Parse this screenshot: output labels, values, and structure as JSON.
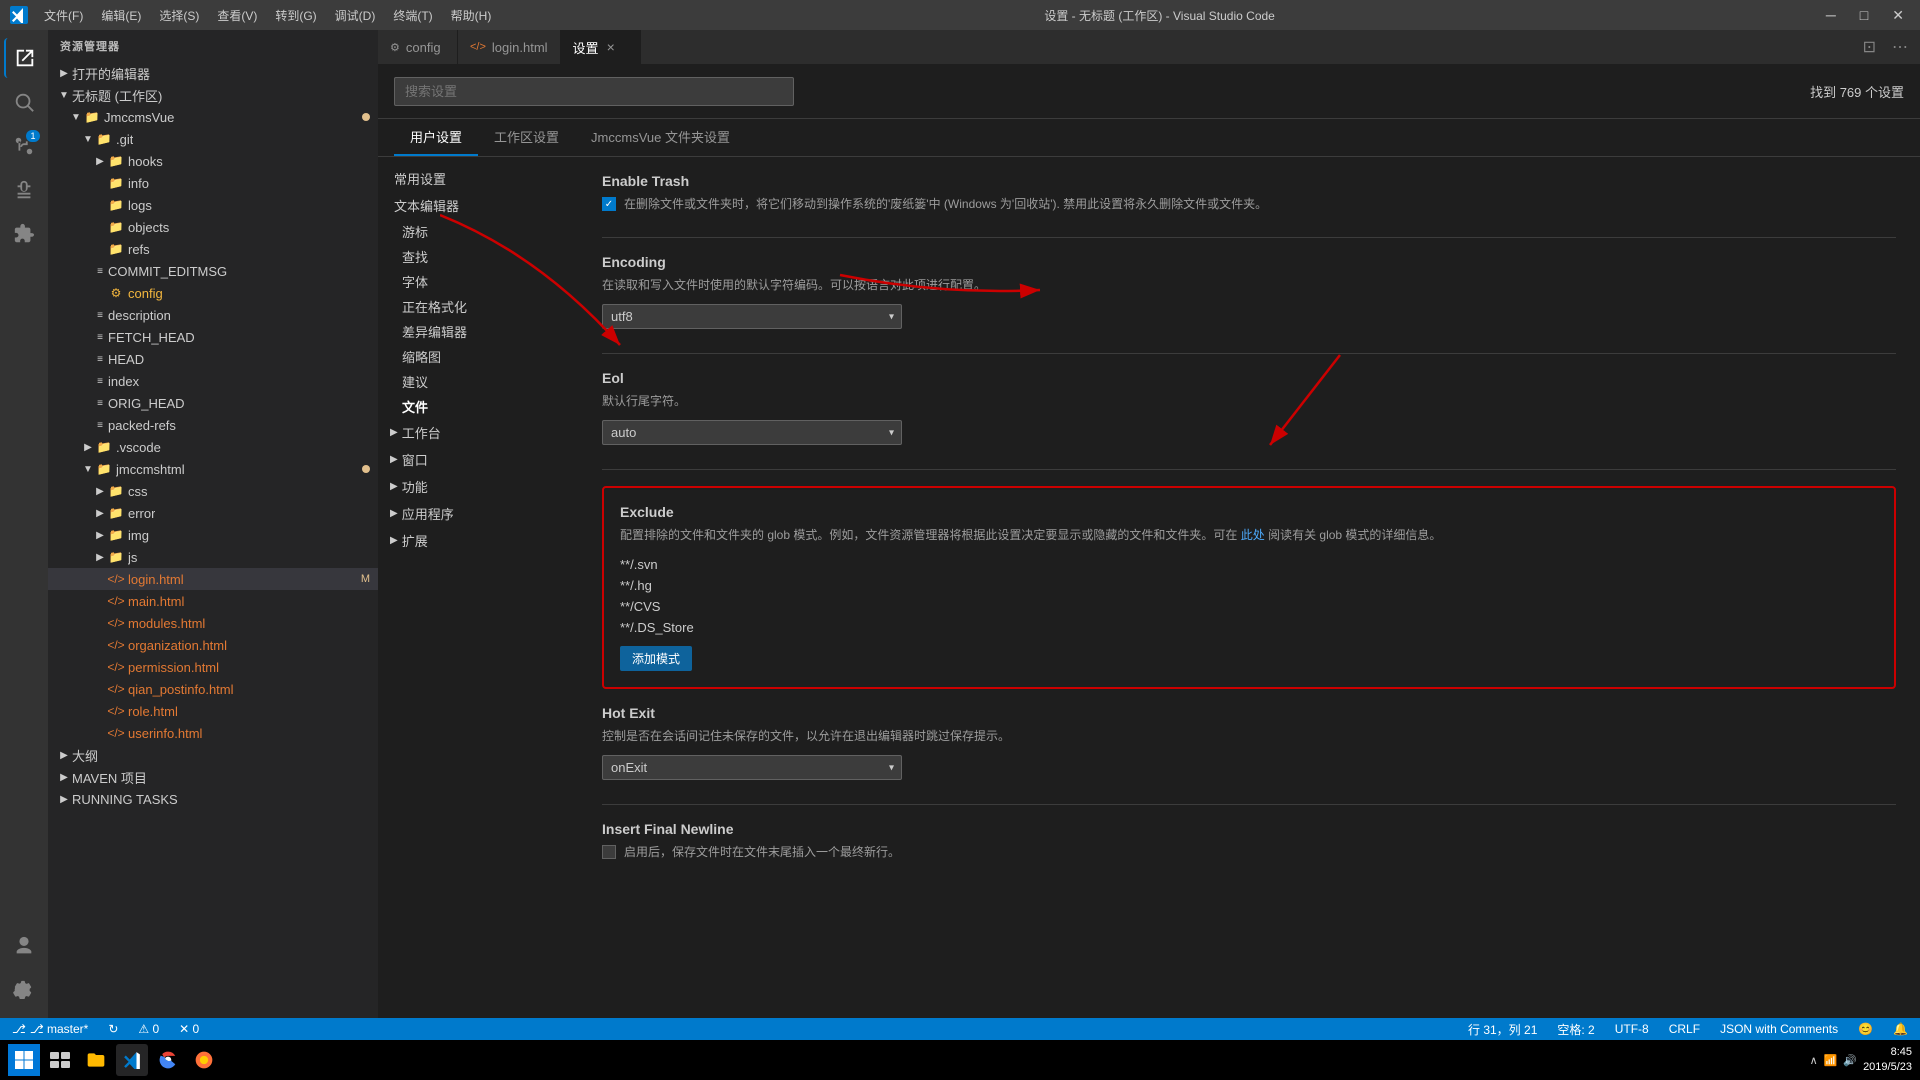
{
  "titleBar": {
    "logo": "VS",
    "menus": [
      "文件(F)",
      "编辑(E)",
      "选择(S)",
      "查看(V)",
      "转到(G)",
      "调试(D)",
      "终端(T)",
      "帮助(H)"
    ],
    "title": "设置 - 无标题 (工作区) - Visual Studio Code",
    "btnMinimize": "─",
    "btnMaximize": "□",
    "btnClose": "✕"
  },
  "activityBar": {
    "icons": [
      {
        "name": "explorer-icon",
        "symbol": "⎘",
        "active": true
      },
      {
        "name": "search-icon",
        "symbol": "🔍",
        "active": false
      },
      {
        "name": "source-control-icon",
        "symbol": "⑂",
        "active": false,
        "badge": "1"
      },
      {
        "name": "debug-icon",
        "symbol": "▷",
        "active": false
      },
      {
        "name": "extensions-icon",
        "symbol": "⊞",
        "active": false
      }
    ],
    "bottomIcons": [
      {
        "name": "account-icon",
        "symbol": "👤"
      },
      {
        "name": "settings-gear-icon",
        "symbol": "⚙"
      }
    ]
  },
  "sidebar": {
    "header": "资源管理器",
    "sections": [
      {
        "label": "打开的编辑器",
        "collapsed": true,
        "indent": 0
      },
      {
        "label": "无标题 (工作区)",
        "collapsed": false,
        "indent": 0
      },
      {
        "label": "JmccmsVue",
        "collapsed": false,
        "indent": 1,
        "dot": true
      },
      {
        "label": ".git",
        "collapsed": false,
        "indent": 2
      },
      {
        "label": "hooks",
        "collapsed": true,
        "indent": 3,
        "isFolder": true
      },
      {
        "label": "info",
        "indent": 3,
        "isFolder": true
      },
      {
        "label": "logs",
        "indent": 3,
        "isFolder": true
      },
      {
        "label": "objects",
        "indent": 3,
        "isFolder": true
      },
      {
        "label": "refs",
        "indent": 3,
        "isFolder": true
      },
      {
        "label": "COMMIT_EDITMSG",
        "indent": 3,
        "isFile": true
      },
      {
        "label": "config",
        "indent": 3,
        "isFile": true,
        "fileColor": "#f4b73e"
      },
      {
        "label": "description",
        "indent": 3,
        "isFile": true
      },
      {
        "label": "FETCH_HEAD",
        "indent": 3,
        "isFile": true
      },
      {
        "label": "HEAD",
        "indent": 3,
        "isFile": true
      },
      {
        "label": "index",
        "indent": 3,
        "isFile": true
      },
      {
        "label": "ORIG_HEAD",
        "indent": 3,
        "isFile": true
      },
      {
        "label": "packed-refs",
        "indent": 3,
        "isFile": true
      },
      {
        "label": ".vscode",
        "indent": 2,
        "isFolder": true
      },
      {
        "label": "jmccmshtml",
        "indent": 2,
        "isFolder": true,
        "collapsed": false,
        "dot": true
      },
      {
        "label": "css",
        "indent": 3,
        "isFolder": true
      },
      {
        "label": "error",
        "indent": 3,
        "isFolder": true
      },
      {
        "label": "img",
        "indent": 3,
        "isFolder": true
      },
      {
        "label": "js",
        "indent": 3,
        "isFolder": true
      },
      {
        "label": "login.html",
        "indent": 3,
        "isFile": true,
        "fileColor": "#e37933",
        "selected": true,
        "badge": "M"
      },
      {
        "label": "main.html",
        "indent": 3,
        "isFile": true,
        "fileColor": "#e37933"
      },
      {
        "label": "modules.html",
        "indent": 3,
        "isFile": true,
        "fileColor": "#e37933"
      },
      {
        "label": "organization.html",
        "indent": 3,
        "isFile": true,
        "fileColor": "#e37933"
      },
      {
        "label": "permission.html",
        "indent": 3,
        "isFile": true,
        "fileColor": "#e37933"
      },
      {
        "label": "qian_postinfo.html",
        "indent": 3,
        "isFile": true,
        "fileColor": "#e37933"
      },
      {
        "label": "role.html",
        "indent": 3,
        "isFile": true,
        "fileColor": "#e37933"
      },
      {
        "label": "userinfo.html",
        "indent": 3,
        "isFile": true,
        "fileColor": "#e37933"
      },
      {
        "label": "大纲",
        "indent": 0,
        "collapsed": true
      },
      {
        "label": "MAVEN 项目",
        "indent": 0,
        "collapsed": true
      },
      {
        "label": "RUNNING TASKS",
        "indent": 0,
        "collapsed": true
      }
    ]
  },
  "tabs": [
    {
      "label": "config",
      "icon": "⚙",
      "active": false,
      "closable": false
    },
    {
      "label": "login.html",
      "icon": "<>",
      "active": false,
      "closable": false
    },
    {
      "label": "设置",
      "icon": "",
      "active": true,
      "closable": true
    }
  ],
  "settings": {
    "searchPlaceholder": "搜索设置",
    "searchCount": "找到 769 个设置",
    "tabs": [
      "用户设置",
      "工作区设置",
      "JmccmsVue 文件夹设置"
    ],
    "activeTab": 0,
    "nav": {
      "items": [
        {
          "label": "常用设置",
          "indent": 0
        },
        {
          "label": "文本编辑器",
          "indent": 0,
          "expanded": true
        },
        {
          "label": "游标",
          "indent": 1
        },
        {
          "label": "查找",
          "indent": 1
        },
        {
          "label": "字体",
          "indent": 1
        },
        {
          "label": "正在格式化",
          "indent": 1
        },
        {
          "label": "差异编辑器",
          "indent": 1
        },
        {
          "label": "缩略图",
          "indent": 1
        },
        {
          "label": "建议",
          "indent": 1
        },
        {
          "label": "文件",
          "indent": 1,
          "bold": true
        },
        {
          "label": "工作台",
          "indent": 0,
          "expandable": true
        },
        {
          "label": "窗口",
          "indent": 0,
          "expandable": true
        },
        {
          "label": "功能",
          "indent": 0,
          "expandable": true
        },
        {
          "label": "应用程序",
          "indent": 0,
          "expandable": true
        },
        {
          "label": "扩展",
          "indent": 0,
          "expandable": true
        }
      ]
    },
    "content": {
      "enableTrash": {
        "title": "Enable Trash",
        "desc": "在删除文件或文件夹时，将它们移动到操作系统的'废纸篓'中 (Windows 为'回收站'). 禁用此设置将永久删除文件或文件夹。",
        "checked": true
      },
      "encoding": {
        "title": "Encoding",
        "desc": "在读取和写入文件时使用的默认字符编码。可以按语言对此项进行配置。",
        "value": "utf8"
      },
      "eol": {
        "title": "Eol",
        "desc": "默认行尾字符。",
        "value": "auto"
      },
      "exclude": {
        "title": "Exclude",
        "desc": "配置排除的文件和文件夹的 glob 模式。例如，文件资源管理器将根据此设置决定要显示或隐藏的文件和文件夹。可在",
        "linkText": "此处",
        "descSuffix": "阅读有关 glob 模式的详细信息。",
        "patterns": [
          "**/.svn",
          "**/.hg",
          "**/CVS",
          "**/.DS_Store"
        ],
        "addBtnLabel": "添加模式"
      },
      "hotExit": {
        "title": "Hot Exit",
        "desc": "控制是否在会话间记住未保存的文件，以允许在退出编辑器时跳过保存提示。",
        "value": "onExit"
      },
      "insertFinalNewline": {
        "title": "Insert Final Newline",
        "desc": "启用后，保存文件时在文件末尾插入一个最终新行。"
      }
    }
  },
  "statusBar": {
    "left": [
      {
        "label": "⎇ master*",
        "name": "git-branch"
      },
      {
        "label": "↻",
        "name": "sync-icon"
      },
      {
        "label": "⚠ 0",
        "name": "warnings"
      },
      {
        "label": "✕ 0",
        "name": "errors"
      }
    ],
    "right": [
      {
        "label": "行 31，列 21",
        "name": "cursor-position"
      },
      {
        "label": "空格: 2",
        "name": "indent"
      },
      {
        "label": "UTF-8",
        "name": "encoding"
      },
      {
        "label": "CRLF",
        "name": "line-ending"
      },
      {
        "label": "JSON with Comments",
        "name": "language-mode"
      },
      {
        "label": "😊",
        "name": "feedback"
      },
      {
        "label": "🔔",
        "name": "notifications"
      }
    ]
  },
  "taskbar": {
    "clock": "8:45\n2019/5/23"
  }
}
